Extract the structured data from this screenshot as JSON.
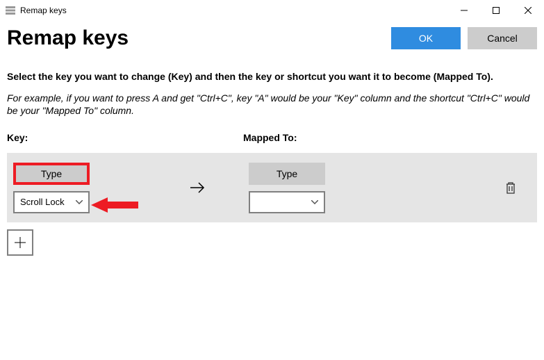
{
  "titlebar": {
    "title": "Remap keys"
  },
  "header": {
    "title": "Remap keys",
    "ok_label": "OK",
    "cancel_label": "Cancel"
  },
  "instructions": {
    "main": "Select the key you want to change (Key) and then the key or shortcut you want it to become (Mapped To).",
    "example": "For example, if you want to press A and get \"Ctrl+C\", key \"A\" would be your \"Key\" column and the shortcut \"Ctrl+C\" would be your \"Mapped To\" column."
  },
  "columns": {
    "key_label": "Key:",
    "mapped_label": "Mapped To:"
  },
  "row": {
    "type_label": "Type",
    "key_selected": "Scroll Lock",
    "mapped_selected": ""
  },
  "annotation": {
    "arrow_color": "#ed1c24",
    "highlight_color": "#ed1c24"
  }
}
